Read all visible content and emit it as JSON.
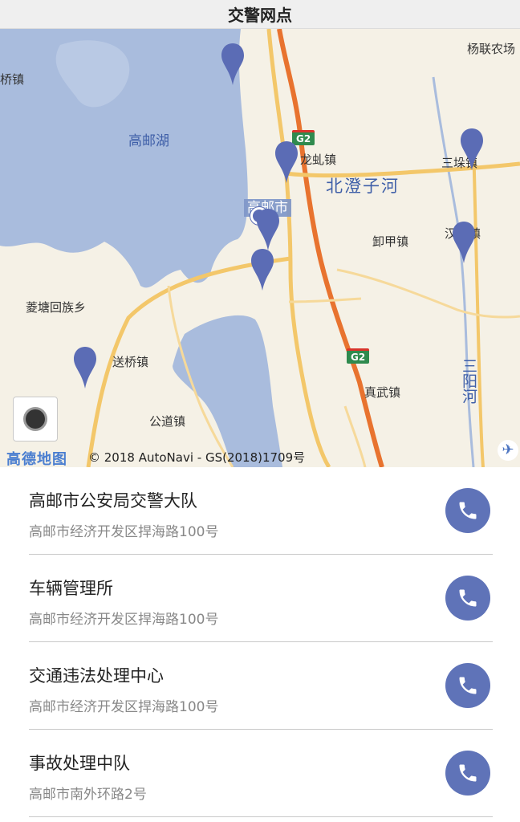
{
  "header": {
    "title": "交警网点"
  },
  "map": {
    "place_labels": [
      {
        "id": "yangjia",
        "text": "杨联农场"
      },
      {
        "id": "qiao",
        "text": "桥镇"
      },
      {
        "id": "longqiu",
        "text": "龙虬镇"
      },
      {
        "id": "sanduo",
        "text": "三垛镇"
      },
      {
        "id": "zhouxiang",
        "text": "汉留镇"
      },
      {
        "id": "xiejia",
        "text": "卸甲镇"
      },
      {
        "id": "lingtang",
        "text": "菱塘回族乡"
      },
      {
        "id": "songqiao",
        "text": "送桥镇"
      },
      {
        "id": "zhenwu",
        "text": "真武镇"
      },
      {
        "id": "gongdao",
        "text": "公道镇"
      }
    ],
    "lake_label": "高邮湖",
    "river_label": "北澄子河",
    "vertical_river_label": "三阳河",
    "city_label": "高邮市",
    "highway_shield": "G2",
    "logo_text": "高德地图",
    "copyright": "© 2018 AutoNavi - GS(2018)1709号",
    "pin_color": "#5b6cb5"
  },
  "stations": [
    {
      "name": "高邮市公安局交警大队",
      "address": "高邮市经济开发区捍海路100号"
    },
    {
      "name": "车辆管理所",
      "address": "高邮市经济开发区捍海路100号"
    },
    {
      "name": "交通违法处理中心",
      "address": "高邮市经济开发区捍海路100号"
    },
    {
      "name": "事故处理中队",
      "address": "高邮市南外环路2号"
    }
  ],
  "colors": {
    "call_button": "#5f73b8",
    "water": "#a9bcdd",
    "highway": "#e8732f",
    "road": "#f3c76a"
  }
}
